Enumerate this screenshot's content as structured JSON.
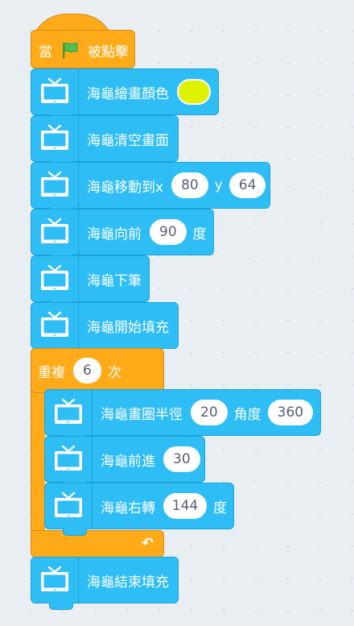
{
  "hat": {
    "when": "當",
    "clicked": "被點擊"
  },
  "blocks": {
    "pen_color": {
      "label": "海龜繪畫顏色",
      "color": "#dff200"
    },
    "clear": {
      "label": "海龜清空畫面"
    },
    "move_to": {
      "label": "海龜移動到x",
      "x": "80",
      "y_label": "y",
      "y": "64"
    },
    "forward1": {
      "label": "海龜向前",
      "value": "90",
      "unit": "度"
    },
    "pen_down": {
      "label": "海龜下筆"
    },
    "begin_fill": {
      "label": "海龜開始填充"
    },
    "repeat": {
      "label": "重複",
      "times": "6",
      "suffix": "次"
    },
    "circle": {
      "label": "海龜畫圈半徑",
      "radius": "20",
      "angle_label": "角度",
      "angle": "360"
    },
    "forward2": {
      "label": "海龜前進",
      "value": "30"
    },
    "turn_right": {
      "label": "海龜右轉",
      "value": "144",
      "unit": "度"
    },
    "end_fill": {
      "label": "海龜結束填充"
    }
  },
  "colors": {
    "motion": "#2ebdf5",
    "control": "#ffab19",
    "event": "#ffab19"
  }
}
